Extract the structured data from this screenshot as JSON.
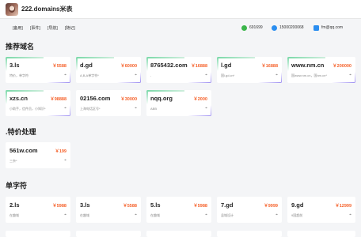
{
  "header": {
    "title": "222.domains米表"
  },
  "nav": [
    {
      "label": "[备用]"
    },
    {
      "label": "[事件]"
    },
    {
      "label": "[导航]"
    },
    {
      "label": "[随记]"
    }
  ],
  "contacts": {
    "wechat": "691699",
    "qq": "15000200068",
    "email": "fm@qq.com"
  },
  "sections": {
    "recommended": {
      "title": "推荐域名",
      "cards": [
        {
          "name": "3.ls",
          "price": "￥5588",
          "desc": "特价，单字符"
        },
        {
          "name": "d.gd",
          "price": "￥60000",
          "desc": "A,B,A单字符*"
        },
        {
          "name": "8765432.com",
          "price": "￥16888",
          "desc": "-"
        },
        {
          "name": "l.gd",
          "price": "￥16888",
          "desc": "国l.gd.cn*"
        },
        {
          "name": "www.nm.cn",
          "price": "￥200000",
          "desc": "国www.nm.cn，国nm.cn*"
        },
        {
          "name": "xzs.cn",
          "price": "￥98888",
          "desc": "小助手，信件员，小知识*"
        },
        {
          "name": "02156.com",
          "price": "￥30000",
          "desc": "上海电话区号*"
        },
        {
          "name": "nqq.org",
          "price": "￥2000",
          "desc": "ABB"
        }
      ]
    },
    "special": {
      "title": ".特价处理",
      "cards": [
        {
          "name": "561w.com",
          "price": "￥199",
          "desc": "三杂*"
        }
      ]
    },
    "single": {
      "title": "单字符",
      "cards": [
        {
          "name": "2.ls",
          "price": "￥5988",
          "desc": "在趣域"
        },
        {
          "name": "3.ls",
          "price": "￥5588",
          "desc": "在趣域"
        },
        {
          "name": "5.ls",
          "price": "￥5988",
          "desc": "在趣域"
        },
        {
          "name": "7.gd",
          "price": "￥9999",
          "desc": "县域设计"
        },
        {
          "name": "9.gd",
          "price": "￥12999",
          "desc": "9国超前"
        }
      ]
    }
  },
  "icons": {
    "tag": "tag-icon"
  }
}
